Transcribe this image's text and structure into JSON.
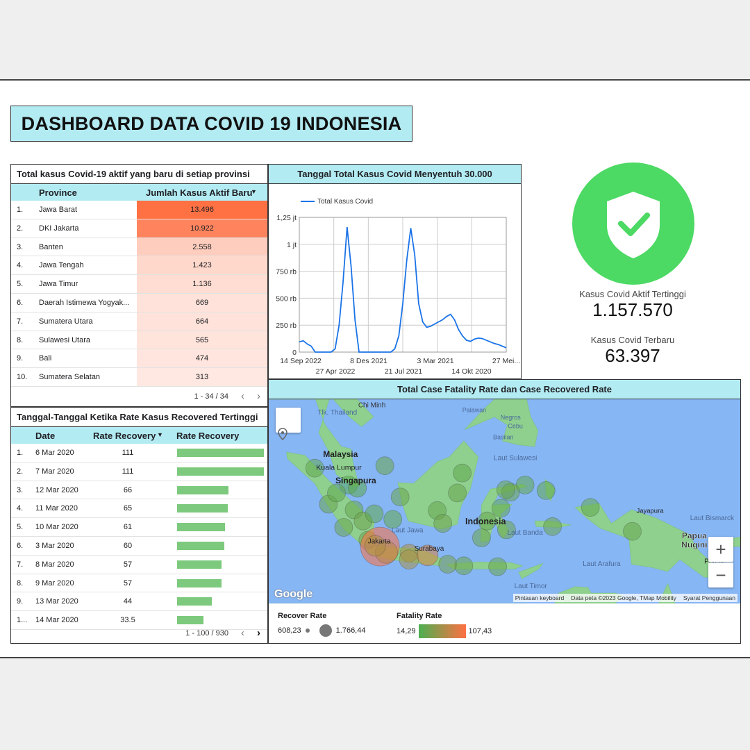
{
  "title": "DASHBOARD DATA COVID 19 INDONESIA",
  "province_table": {
    "heading": "Total kasus Covid-19 aktif yang baru di setiap provinsi",
    "col_province": "Province",
    "col_value": "Jumlah Kasus Aktif Baru",
    "sort_icon": "sort-down-icon",
    "rows": [
      {
        "n": "1.",
        "province": "Jawa Barat",
        "value": "13.496",
        "num": 13496
      },
      {
        "n": "2.",
        "province": "DKI Jakarta",
        "value": "10.922",
        "num": 10922
      },
      {
        "n": "3.",
        "province": "Banten",
        "value": "2.558",
        "num": 2558
      },
      {
        "n": "4.",
        "province": "Jawa Tengah",
        "value": "1.423",
        "num": 1423
      },
      {
        "n": "5.",
        "province": "Jawa Timur",
        "value": "1.136",
        "num": 1136
      },
      {
        "n": "6.",
        "province": "Daerah Istimewa Yogyak...",
        "value": "669",
        "num": 669
      },
      {
        "n": "7.",
        "province": "Sumatera Utara",
        "value": "664",
        "num": 664
      },
      {
        "n": "8.",
        "province": "Sulawesi Utara",
        "value": "565",
        "num": 565
      },
      {
        "n": "9.",
        "province": "Bali",
        "value": "474",
        "num": 474
      },
      {
        "n": "10.",
        "province": "Sumatera Selatan",
        "value": "313",
        "num": 313
      }
    ],
    "pager": "1 - 34 / 34",
    "prev": "‹",
    "next": "›"
  },
  "recovery_table": {
    "heading": "Tanggal-Tanggal Ketika Rate Kasus Recovered Tertinggi",
    "col_date": "Date",
    "col_rate": "Rate Recovery",
    "col_bar": "Rate Recovery",
    "rows": [
      {
        "n": "1.",
        "date": "6 Mar 2020",
        "value": "111",
        "num": 111
      },
      {
        "n": "2.",
        "date": "7 Mar 2020",
        "value": "111",
        "num": 111
      },
      {
        "n": "3.",
        "date": "12 Mar 2020",
        "value": "66",
        "num": 66
      },
      {
        "n": "4.",
        "date": "11 Mar 2020",
        "value": "65",
        "num": 65
      },
      {
        "n": "5.",
        "date": "10 Mar 2020",
        "value": "61",
        "num": 61
      },
      {
        "n": "6.",
        "date": "3 Mar 2020",
        "value": "60",
        "num": 60
      },
      {
        "n": "7.",
        "date": "8 Mar 2020",
        "value": "57",
        "num": 57
      },
      {
        "n": "8.",
        "date": "9 Mar 2020",
        "value": "57",
        "num": 57
      },
      {
        "n": "9.",
        "date": "13 Mar 2020",
        "value": "44",
        "num": 44
      },
      {
        "n": "1...",
        "date": "14 Mar 2020",
        "value": "33.5",
        "num": 33.5
      }
    ],
    "pager": "1 - 100 / 930",
    "prev": "‹",
    "next": "›"
  },
  "line_panel": {
    "heading": "Tanggal Total Kasus Covid Menyentuh 30.000"
  },
  "chart_data": {
    "type": "line",
    "legend_position": "top-left",
    "series": [
      {
        "name": "Total Kasus Covid",
        "color": "#1a73e8",
        "y": [
          95000,
          105000,
          75000,
          55000,
          0,
          0,
          0,
          0,
          0,
          30000,
          250000,
          650000,
          1160000,
          800000,
          300000,
          0,
          0,
          0,
          0,
          0,
          0,
          0,
          0,
          0,
          30000,
          150000,
          450000,
          850000,
          1150000,
          900000,
          450000,
          280000,
          230000,
          240000,
          260000,
          280000,
          300000,
          330000,
          350000,
          300000,
          210000,
          150000,
          110000,
          100000,
          120000,
          130000,
          125000,
          110000,
          95000,
          80000,
          70000,
          55000,
          40000
        ]
      }
    ],
    "y_ticks": [
      "0",
      "250 rb",
      "500 rb",
      "750 rb",
      "1 jt",
      "1,25 jt"
    ],
    "ylim": [
      0,
      1250000
    ],
    "x_ticks_row1": [
      "14 Sep 2022",
      "8 Des 2021",
      "3 Mar 2021",
      "27 Mei..."
    ],
    "x_ticks_row2": [
      "27 Apr 2022",
      "21 Jul 2021",
      "14 Okt 2020"
    ],
    "grid": true
  },
  "kpi": {
    "icon": "shield-check-icon",
    "active_label": "Kasus Covid Aktif Tertinggi",
    "active_value": "1.157.570",
    "new_label": "Kasus Covid Terbaru",
    "new_value": "63.397"
  },
  "map_panel": {
    "heading": "Total Case Fatality Rate dan Case Recovered Rate",
    "labels": [
      "Tlk. Thailand",
      "Chi Minh",
      "Malaysia",
      "Kuala Lumpur",
      "Singapura",
      "Palawan",
      "Negros",
      "Cebu",
      "Basilan",
      "Laut Sulawesi",
      "Indonesia",
      "Laut Jawa",
      "Jakarta",
      "Surabaya",
      "Laut Banda",
      "Jayapura",
      "Laut Bismarck",
      "Papua Nugini",
      "Port M",
      "Laut Arafura",
      "Laut Timor"
    ],
    "google": "Google",
    "attribution": [
      "Pintasan keyboard",
      "Data peta ©2023 Google, TMap Mobility",
      "Syarat Penggunaan"
    ],
    "zoom_in": "+",
    "zoom_out": "−",
    "locate_icon": "location-pin-icon",
    "bubbles": [
      {
        "lon": 98.7,
        "lat": 3.6,
        "r": 13,
        "fatality": 25
      },
      {
        "lon": 102.9,
        "lat": 1.5,
        "r": 13,
        "fatality": 20
      },
      {
        "lon": 100.4,
        "lat": -0.9,
        "r": 13,
        "fatality": 30
      },
      {
        "lon": 101.4,
        "lat": 0.5,
        "r": 13,
        "fatality": 25
      },
      {
        "lon": 104.0,
        "lat": 1.1,
        "r": 13,
        "fatality": 22
      },
      {
        "lon": 103.6,
        "lat": -1.6,
        "r": 13,
        "fatality": 28
      },
      {
        "lon": 104.7,
        "lat": -3.0,
        "r": 13,
        "fatality": 32
      },
      {
        "lon": 105.3,
        "lat": -5.4,
        "r": 13,
        "fatality": 35
      },
      {
        "lon": 102.3,
        "lat": -3.8,
        "r": 13,
        "fatality": 30
      },
      {
        "lon": 106.1,
        "lat": -2.1,
        "r": 13,
        "fatality": 25
      },
      {
        "lon": 107.4,
        "lat": 3.9,
        "r": 13,
        "fatality": 30
      },
      {
        "lon": 108.4,
        "lat": -2.8,
        "r": 13,
        "fatality": 25
      },
      {
        "lon": 106.8,
        "lat": -6.2,
        "r": 28,
        "fatality": 107
      },
      {
        "lon": 107.6,
        "lat": -6.9,
        "r": 16,
        "fatality": 70
      },
      {
        "lon": 106.2,
        "lat": -6.1,
        "r": 15,
        "fatality": 65
      },
      {
        "lon": 110.4,
        "lat": -7.0,
        "r": 13,
        "fatality": 65
      },
      {
        "lon": 110.4,
        "lat": -7.8,
        "r": 14,
        "fatality": 60
      },
      {
        "lon": 112.7,
        "lat": -7.3,
        "r": 15,
        "fatality": 85
      },
      {
        "lon": 109.3,
        "lat": 0.0,
        "r": 13,
        "fatality": 30
      },
      {
        "lon": 113.9,
        "lat": -1.7,
        "r": 13,
        "fatality": 28
      },
      {
        "lon": 114.6,
        "lat": -3.3,
        "r": 13,
        "fatality": 32
      },
      {
        "lon": 116.4,
        "lat": 0.5,
        "r": 13,
        "fatality": 30
      },
      {
        "lon": 117.0,
        "lat": 3.0,
        "r": 13,
        "fatality": 25
      },
      {
        "lon": 115.2,
        "lat": -8.4,
        "r": 13,
        "fatality": 35
      },
      {
        "lon": 117.2,
        "lat": -8.6,
        "r": 13,
        "fatality": 30
      },
      {
        "lon": 121.4,
        "lat": -8.7,
        "r": 13,
        "fatality": 28
      },
      {
        "lon": 119.4,
        "lat": -5.1,
        "r": 13,
        "fatality": 30
      },
      {
        "lon": 120.1,
        "lat": -3.0,
        "r": 13,
        "fatality": 28
      },
      {
        "lon": 121.8,
        "lat": -1.4,
        "r": 13,
        "fatality": 25
      },
      {
        "lon": 122.5,
        "lat": -4.1,
        "r": 13,
        "fatality": 30
      },
      {
        "lon": 124.8,
        "lat": 1.5,
        "r": 13,
        "fatality": 25
      },
      {
        "lon": 123.0,
        "lat": 0.6,
        "r": 13,
        "fatality": 30
      },
      {
        "lon": 122.4,
        "lat": 0.9,
        "r": 13,
        "fatality": 28
      },
      {
        "lon": 127.4,
        "lat": 0.8,
        "r": 13,
        "fatality": 25
      },
      {
        "lon": 128.2,
        "lat": -3.7,
        "r": 13,
        "fatality": 30
      },
      {
        "lon": 132.9,
        "lat": -1.3,
        "r": 13,
        "fatality": 25
      },
      {
        "lon": 138.1,
        "lat": -4.3,
        "r": 13,
        "fatality": 28
      }
    ]
  },
  "legend": {
    "recover_title": "Recover Rate",
    "recover_min": "608,23",
    "recover_max": "1.766,44",
    "fatality_title": "Fatality Rate",
    "fatality_min": "14,29",
    "fatality_max": "107,43"
  },
  "colors": {
    "header": "#b3ebf3",
    "accent_line": "#1a73e8",
    "heat_high": "#ff7043",
    "bar": "#7dc97d",
    "kpi_circle": "#4cd964",
    "map_water": "#87b6f4",
    "map_land": "#8fd08f"
  }
}
